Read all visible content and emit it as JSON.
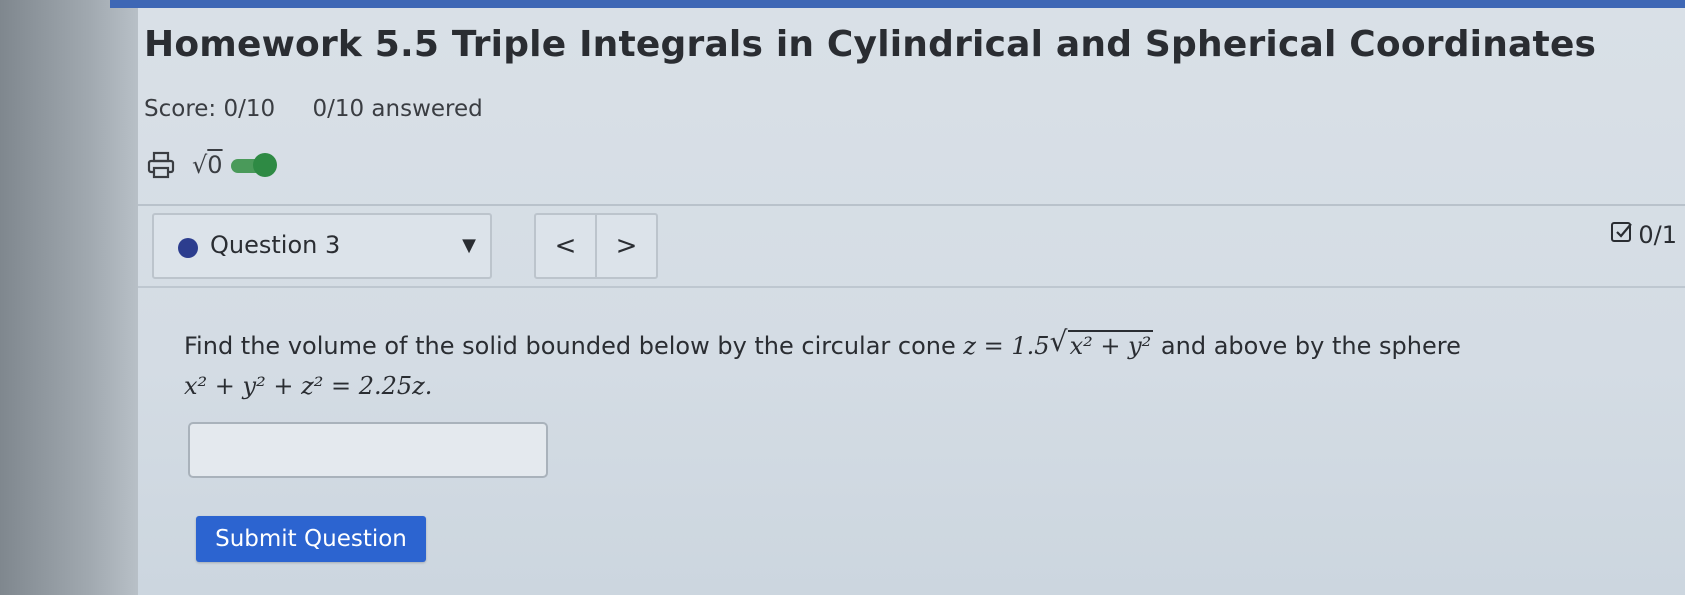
{
  "header": {
    "title": "Homework 5.5 Triple Integrals in Cylindrical and Spherical Coordinates",
    "score_label": "Score: 0/10",
    "answered_label": "0/10 answered"
  },
  "tools": {
    "math_toggle_label": "√0",
    "math_toggle_radicand": "0",
    "math_toggle_state": "on",
    "toggle_color": "#2e8a44"
  },
  "question_nav": {
    "selected_question": "Question 3",
    "prev_symbol": "<",
    "next_symbol": ">",
    "status_dot_color": "#2c3d8e"
  },
  "question_score": "0/1",
  "problem": {
    "text_before": "Find the volume of the solid bounded below by the circular cone",
    "cone_lhs": "z = 1.5",
    "cone_radicand": "x² + y²",
    "text_after": "and above by the sphere",
    "sphere_equation": "x² + y² + z² = 2.25z."
  },
  "answer": {
    "value": ""
  },
  "submit_label": "Submit Question",
  "colors": {
    "accent": "#2c64d0",
    "topbar": "#3e67b5"
  }
}
